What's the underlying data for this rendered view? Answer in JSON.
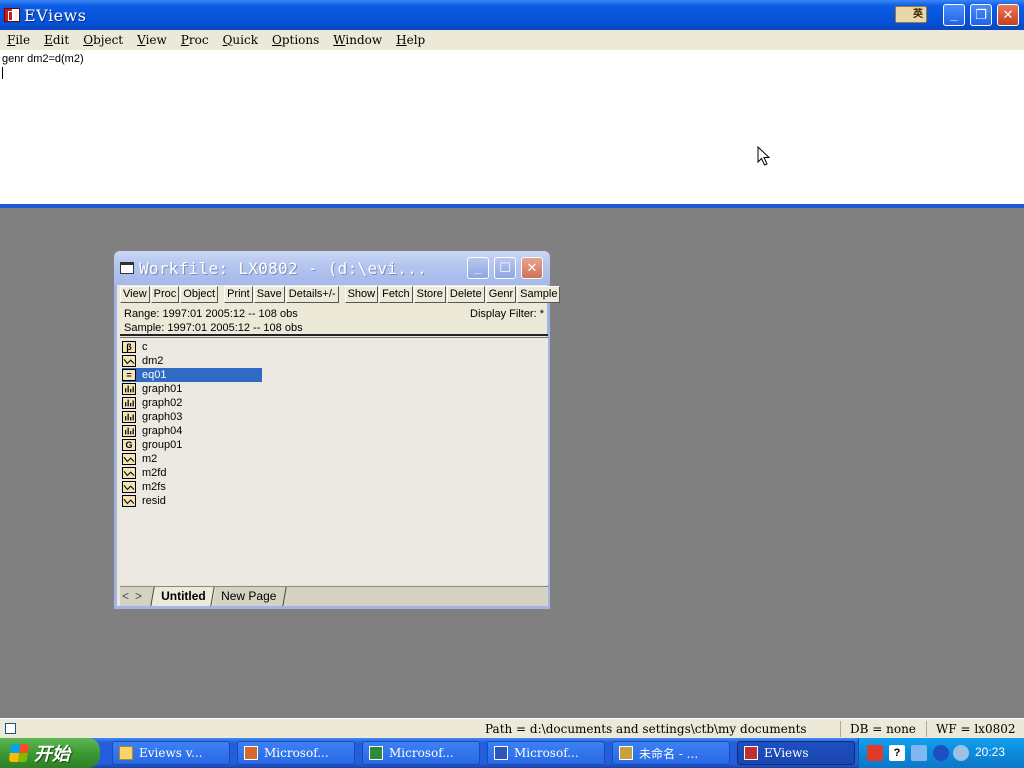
{
  "app": {
    "title": "EViews"
  },
  "ime": {
    "label": "英"
  },
  "menu": [
    "File",
    "Edit",
    "Object",
    "View",
    "Proc",
    "Quick",
    "Options",
    "Window",
    "Help"
  ],
  "command": {
    "text": "genr dm2=d(m2)"
  },
  "workfile": {
    "title": "Workfile: LX0802 - (d:\\evi...",
    "toolbar": [
      "View",
      "Proc",
      "Object",
      "Print",
      "Save",
      "Details+/-",
      "Show",
      "Fetch",
      "Store",
      "Delete",
      "Genr",
      "Sample"
    ],
    "range": "Range:  1997:01 2005:12  --  108 obs",
    "sample": "Sample: 1997:01 2005:12  --  108 obs",
    "filter": "Display Filter: *",
    "objects": [
      {
        "name": "c",
        "icon": "β"
      },
      {
        "name": "dm2",
        "icon": "series"
      },
      {
        "name": "eq01",
        "icon": "="
      },
      {
        "name": "graph01",
        "icon": "graph"
      },
      {
        "name": "graph02",
        "icon": "graph"
      },
      {
        "name": "graph03",
        "icon": "graph"
      },
      {
        "name": "graph04",
        "icon": "graph"
      },
      {
        "name": "group01",
        "icon": "G"
      },
      {
        "name": "m2",
        "icon": "series"
      },
      {
        "name": "m2fd",
        "icon": "series"
      },
      {
        "name": "m2fs",
        "icon": "series"
      },
      {
        "name": "resid",
        "icon": "series"
      }
    ],
    "selected": "eq01",
    "tabs": {
      "active": "Untitled",
      "new": "New Page"
    }
  },
  "status": {
    "path": "Path = d:\\documents and settings\\ctb\\my documents",
    "db": "DB = none",
    "wf": "WF = lx0802"
  },
  "taskbar": {
    "start": "开始",
    "tasks": [
      "Eviews v...",
      "Microsof...",
      "Microsof...",
      "Microsof...",
      "未命名 - ...",
      "EViews"
    ],
    "active_task": "EViews",
    "clock": "20:23"
  }
}
